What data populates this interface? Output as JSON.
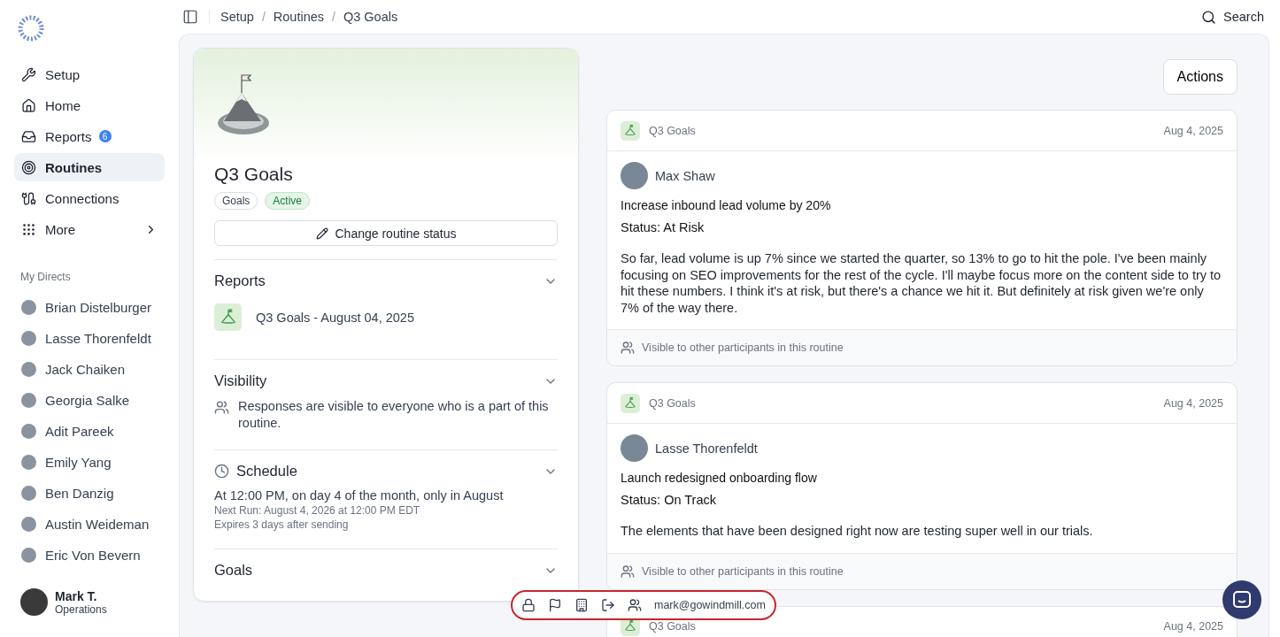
{
  "sidebar": {
    "nav": [
      {
        "label": "Setup",
        "selected": false
      },
      {
        "label": "Home",
        "selected": false
      },
      {
        "label": "Reports",
        "badge": "6",
        "selected": false
      },
      {
        "label": "Routines",
        "selected": true
      },
      {
        "label": "Connections",
        "selected": false
      },
      {
        "label": "More",
        "selected": false
      }
    ],
    "directs_heading": "My Directs",
    "directs": [
      {
        "name": "Brian Distelburger"
      },
      {
        "name": "Lasse Thorenfeldt"
      },
      {
        "name": "Jack Chaiken"
      },
      {
        "name": "Georgia Salke"
      },
      {
        "name": "Adit Pareek"
      },
      {
        "name": "Emily Yang"
      },
      {
        "name": "Ben Danzig"
      },
      {
        "name": "Austin Weideman"
      },
      {
        "name": "Eric Von Bevern"
      }
    ],
    "user": {
      "name": "Mark T.",
      "role": "Operations"
    }
  },
  "breadcrumb": [
    "Setup",
    "Routines",
    "Q3 Goals"
  ],
  "breadcrumb_separator": "/",
  "search": "Search",
  "routine": {
    "title": "Q3 Goals",
    "tags": [
      {
        "label": "Goals",
        "kind": "plain"
      },
      {
        "label": "Active",
        "kind": "status"
      }
    ],
    "change_button": "Change routine status",
    "sections": [
      {
        "kind": "reports",
        "title": "Reports",
        "items": [
          "Q3 Goals - August 04, 2025"
        ]
      },
      {
        "kind": "visibility",
        "title": "Visibility",
        "text": "Responses are visible to everyone who is a part of this routine."
      },
      {
        "kind": "schedule",
        "title": "Schedule",
        "lines": [
          "At 12:00 PM, on day 4 of the month, only in August",
          "Next Run: August 4, 2026 at 12:00 PM EDT",
          "Expires 3 days after sending"
        ]
      },
      {
        "kind": "goals",
        "title": "Goals"
      }
    ]
  },
  "actions_button": "Actions",
  "responses": [
    {
      "routine": "Q3 Goals",
      "date": "Aug 4, 2025",
      "author": "Max Shaw",
      "goal": "Increase inbound lead volume by 20%",
      "status": "Status: At Risk",
      "body": "So far, lead volume is up 7% since we started the quarter, so 13% to go to hit the pole. I've been mainly focusing on SEO improvements for the rest of the cycle. I'll maybe focus more on the content side to try to hit these numbers. I think it's at risk, but there's a chance we hit it. But definitely at risk given we're only 7% of the way there.",
      "footer": "Visible to other participants in this routine"
    },
    {
      "routine": "Q3 Goals",
      "date": "Aug 4, 2025",
      "author": "Lasse Thorenfeldt",
      "goal": "Launch redesigned onboarding flow",
      "status": "Status: On Track",
      "body": "The elements that have been designed right now are testing super well in our trials.",
      "footer": "Visible to other participants in this routine"
    },
    {
      "routine": "Q3 Goals",
      "date": "Aug 4, 2025"
    }
  ],
  "toolbar": {
    "email": "mark@gowindmill.com"
  }
}
